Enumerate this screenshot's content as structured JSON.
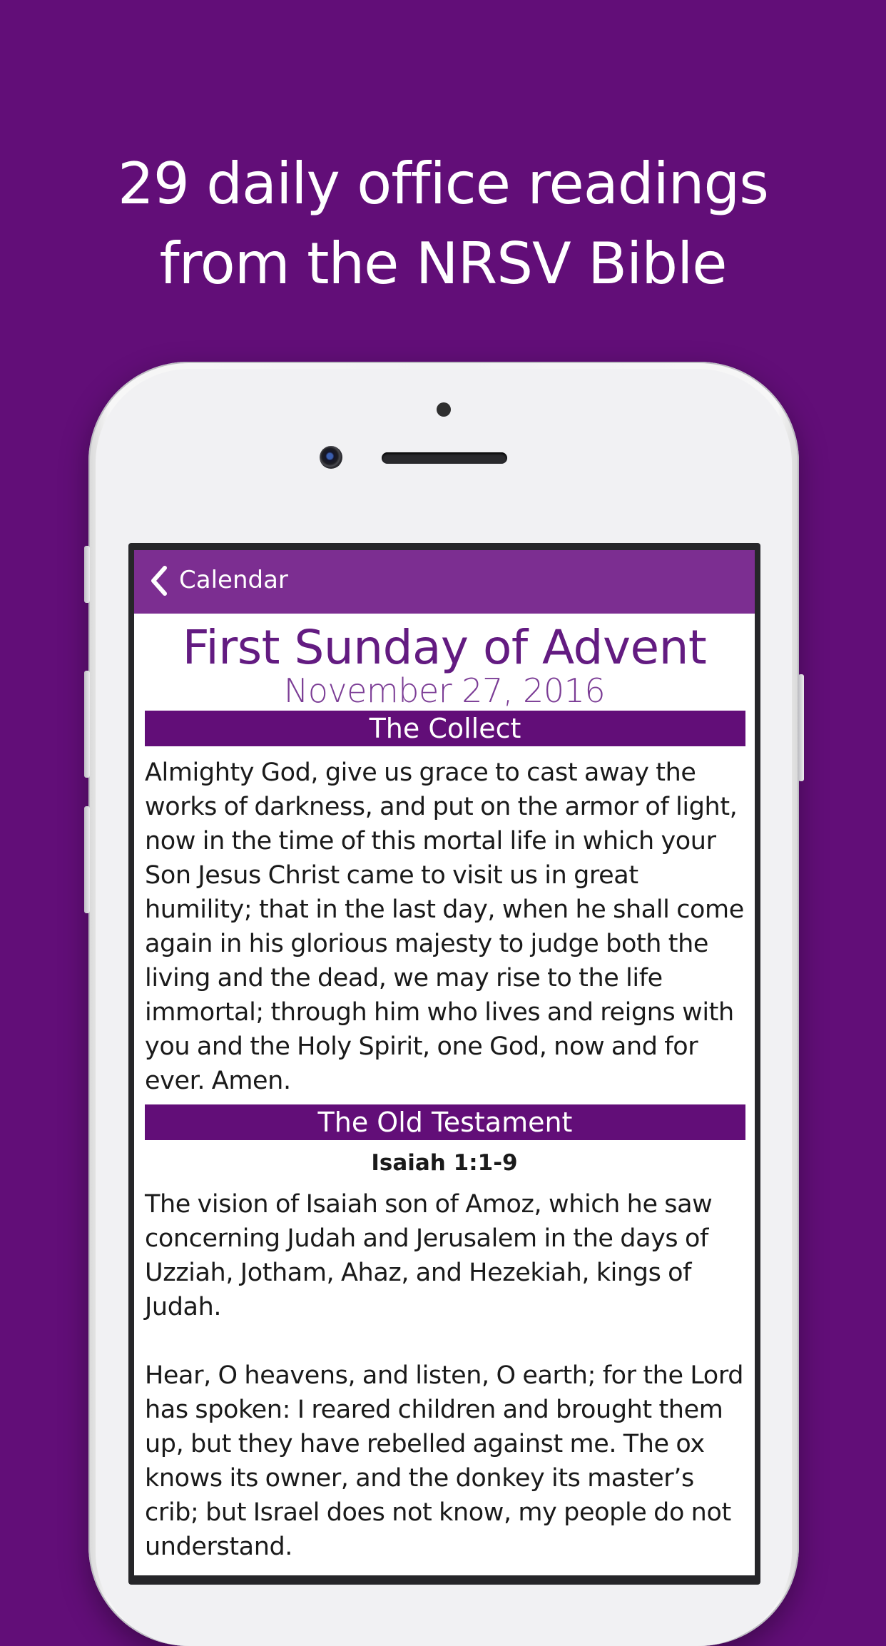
{
  "headline": {
    "line1": "29 daily office readings",
    "line2": "from the NRSV Bible"
  },
  "colors": {
    "background": "#620e78",
    "navbar": "#7c2e91",
    "section_header": "#620e78",
    "title_text": "#631b81"
  },
  "navbar": {
    "back_icon": "chevron-left-icon",
    "back_label": "Calendar"
  },
  "reading": {
    "title": "First Sunday of Advent",
    "date": "November 27, 2016",
    "sections": [
      {
        "header": "The Collect",
        "paragraphs": [
          "Almighty God, give us grace to cast away the works of darkness, and put on the armor of light, now in the time of this mortal life in which your Son Jesus Christ came to visit us in great humility; that in the last day, when he shall come again in his glorious majesty to judge both the living and the dead, we may rise to the life immortal; through him who lives and reigns with you and the Holy Spirit, one God, now and for ever. Amen."
        ]
      },
      {
        "header": "The Old Testament",
        "reference": "Isaiah 1:1-9",
        "paragraphs": [
          "The vision of Isaiah son of Amoz, which he saw concerning Judah and Jerusalem in the days of Uzziah, Jotham, Ahaz, and Hezekiah, kings of Judah.",
          "Hear, O heavens, and listen, O earth; for the Lord has spoken: I reared children and brought them up, but they have rebelled against me. The ox knows its owner, and the donkey its master’s crib; but Israel does not know, my people do not understand."
        ]
      }
    ]
  }
}
